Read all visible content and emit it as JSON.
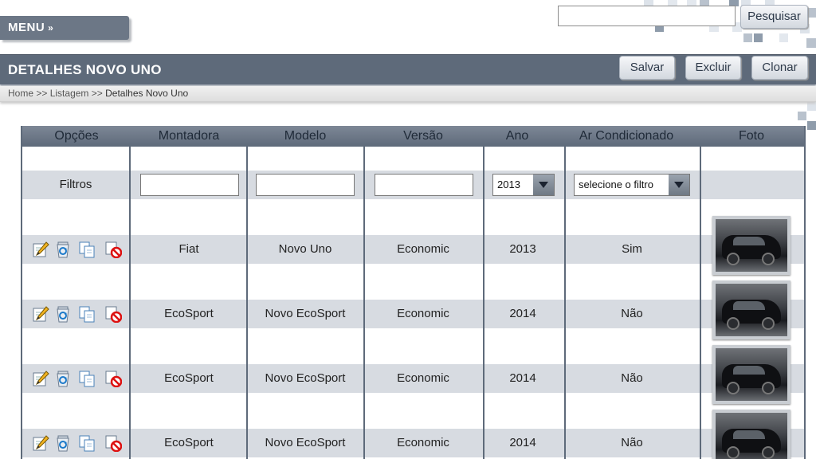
{
  "header": {
    "menu_label": "MENU",
    "search_value": "",
    "search_button": "Pesquisar"
  },
  "titlebar": {
    "title": "DETALHES NOVO UNO",
    "save_label": "Salvar",
    "delete_label": "Excluir",
    "clone_label": "Clonar"
  },
  "breadcrumb": {
    "home": "Home",
    "sep": ">>",
    "list": "Listagem",
    "current": "Detalhes Novo Uno"
  },
  "table": {
    "columns": [
      "Opções",
      "Montadora",
      "Modelo",
      "Versão",
      "Ano",
      "Ar Condicionado",
      "Foto"
    ],
    "filter_label": "Filtros",
    "filter_year": "2013",
    "filter_ac": "selecione o filtro",
    "rows": [
      {
        "montadora": "Fiat",
        "modelo": "Novo Uno",
        "versao": "Economic",
        "ano": "2013",
        "ar": "Sim"
      },
      {
        "montadora": "EcoSport",
        "modelo": "Novo EcoSport",
        "versao": "Economic",
        "ano": "2014",
        "ar": "Não"
      },
      {
        "montadora": "EcoSport",
        "modelo": "Novo EcoSport",
        "versao": "Economic",
        "ano": "2014",
        "ar": "Não"
      },
      {
        "montadora": "EcoSport",
        "modelo": "Novo EcoSport",
        "versao": "Economic",
        "ano": "2014",
        "ar": "Não"
      }
    ]
  },
  "icons": {
    "edit": "edit-icon",
    "recycle": "recycle-icon",
    "clone": "clone-icon",
    "disable": "disable-icon"
  }
}
